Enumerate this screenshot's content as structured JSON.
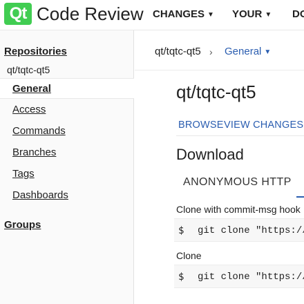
{
  "header": {
    "logo_text": "Qt",
    "brand": "Code Review",
    "nav": [
      {
        "label": "CHANGES"
      },
      {
        "label": "YOUR"
      },
      {
        "label": "DO"
      }
    ]
  },
  "sidebar": {
    "repositories_label": "Repositories",
    "repo_name": "qt/tqtc-qt5",
    "items": [
      {
        "label": "General"
      },
      {
        "label": "Access"
      },
      {
        "label": "Commands"
      },
      {
        "label": "Branches"
      },
      {
        "label": "Tags"
      },
      {
        "label": "Dashboards"
      }
    ],
    "groups_label": "Groups"
  },
  "breadcrumb": {
    "repo": "qt/tqtc-qt5",
    "separator": "›",
    "current": "General"
  },
  "main": {
    "title": "qt/tqtc-qt5",
    "tabs": [
      {
        "label": "BROWSE"
      },
      {
        "label": "VIEW CHANGES"
      }
    ],
    "download": {
      "title": "Download",
      "scheme_tab": "ANONYMOUS HTTP",
      "commands": [
        {
          "label": "Clone with commit-msg hook",
          "prompt": "$",
          "command": "git clone \"https://"
        },
        {
          "label": "Clone",
          "prompt": "$",
          "command": "git clone \"https://"
        }
      ]
    }
  },
  "colors": {
    "brand_green": "#41cd52",
    "link_blue": "#2a5db0"
  }
}
